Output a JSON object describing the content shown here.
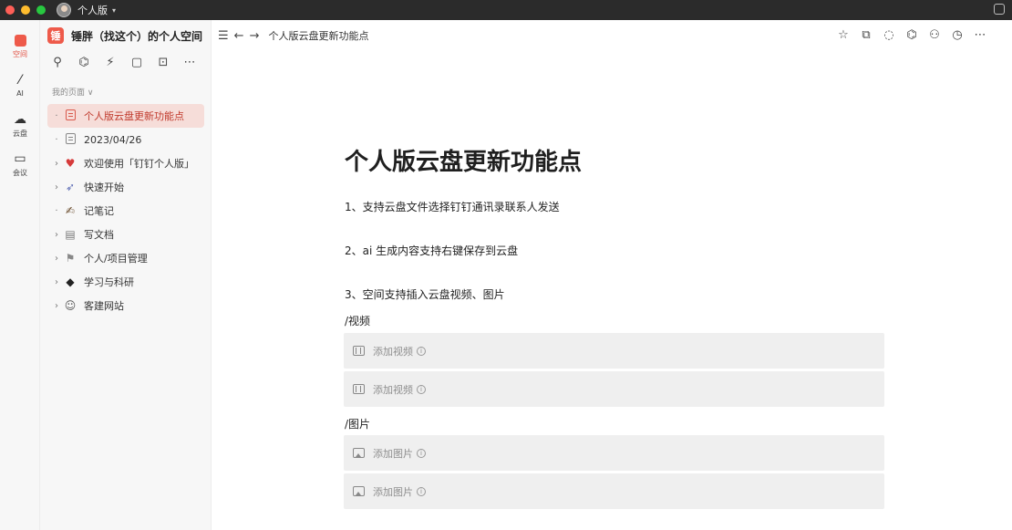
{
  "titlebar": {
    "account": "个人版"
  },
  "rail": {
    "items": [
      {
        "label": "空间",
        "icon": "space-icon"
      },
      {
        "label": "AI",
        "icon": "ai-wand-icon"
      },
      {
        "label": "云盘",
        "icon": "cloud-icon"
      },
      {
        "label": "会议",
        "icon": "video-icon"
      }
    ]
  },
  "sidebar": {
    "space_title": "锤胖（找这个）的个人空间",
    "logo_char": "锤",
    "section_label": "我的页面 ∨",
    "tree": [
      {
        "label": "个人版云盘更新功能点",
        "icon": "doc-icon"
      },
      {
        "label": "2023/04/26",
        "icon": "doc-icon"
      },
      {
        "label": "欢迎使用「钉钉个人版」",
        "icon": "heart-icon"
      },
      {
        "label": "快速开始",
        "icon": "rocket-icon"
      },
      {
        "label": "记笔记",
        "icon": "pen-icon"
      },
      {
        "label": "写文档",
        "icon": "notepad-icon"
      },
      {
        "label": "个人/项目管理",
        "icon": "pin-icon"
      },
      {
        "label": "学习与科研",
        "icon": "graduation-cap-icon"
      },
      {
        "label": "客建网站",
        "icon": "builder-icon"
      }
    ]
  },
  "topbar": {
    "breadcrumb": "个人版云盘更新功能点"
  },
  "doc": {
    "title": "个人版云盘更新功能点",
    "p1": "1、支持云盘文件选择钉钉通讯录联系人发送",
    "p2": "2、ai 生成内容支持右键保存到云盘",
    "p3": "3、空间支持插入云盘视频、图片",
    "video_heading": "/视频",
    "image_heading": "/图片",
    "add_video": "添加视频",
    "add_image": "添加图片"
  },
  "colors": {
    "accent": "#ee5a4a",
    "selected_bg": "#f6ddd9"
  }
}
